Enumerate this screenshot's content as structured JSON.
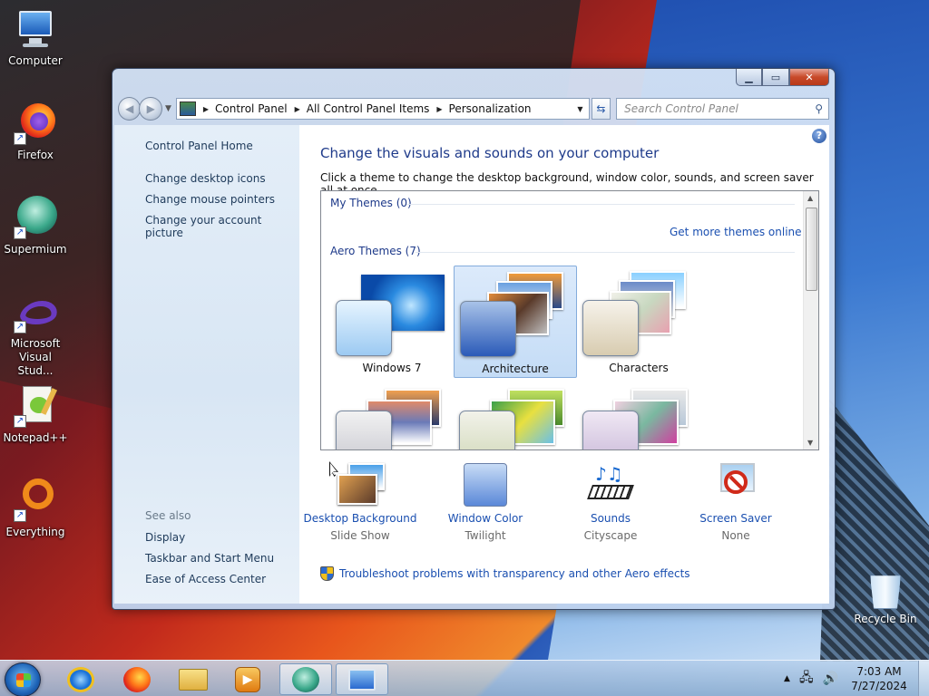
{
  "desktop": {
    "icons": [
      {
        "label": "Computer",
        "icon": "computer-icon"
      },
      {
        "label": "Firefox",
        "icon": "firefox-icon"
      },
      {
        "label": "Supermium",
        "icon": "supermium-icon"
      },
      {
        "label": "Microsoft Visual Stud...",
        "icon": "visual-studio-icon"
      },
      {
        "label": "Notepad++",
        "icon": "notepad-plus-plus-icon"
      },
      {
        "label": "Everything",
        "icon": "everything-icon"
      }
    ],
    "recycle_bin": "Recycle Bin"
  },
  "window": {
    "breadcrumb": [
      "Control Panel",
      "All Control Panel Items",
      "Personalization"
    ],
    "search_placeholder": "Search Control Panel",
    "sidebar": {
      "home": "Control Panel Home",
      "links": [
        "Change desktop icons",
        "Change mouse pointers",
        "Change your account picture"
      ],
      "see_also_label": "See also",
      "see_also": [
        "Display",
        "Taskbar and Start Menu",
        "Ease of Access Center"
      ]
    },
    "heading": "Change the visuals and sounds on your computer",
    "subheading": "Click a theme to change the desktop background, window color, sounds, and screen saver all at once.",
    "themes": {
      "my_themes": "My Themes (0)",
      "get_more": "Get more themes online",
      "aero_themes": "Aero Themes (7)",
      "items": [
        "Windows 7",
        "Architecture",
        "Characters"
      ],
      "selected": "Architecture"
    },
    "settings": [
      {
        "link": "Desktop Background",
        "value": "Slide Show"
      },
      {
        "link": "Window Color",
        "value": "Twilight"
      },
      {
        "link": "Sounds",
        "value": "Cityscape"
      },
      {
        "link": "Screen Saver",
        "value": "None"
      }
    ],
    "troubleshoot": "Troubleshoot problems with transparency and other Aero effects"
  },
  "taskbar": {
    "time": "7:03 AM",
    "date": "7/27/2024"
  },
  "colors": {
    "link": "#1a4fb0",
    "heading": "#1e3a8a",
    "selection": "#c4dcf6"
  }
}
